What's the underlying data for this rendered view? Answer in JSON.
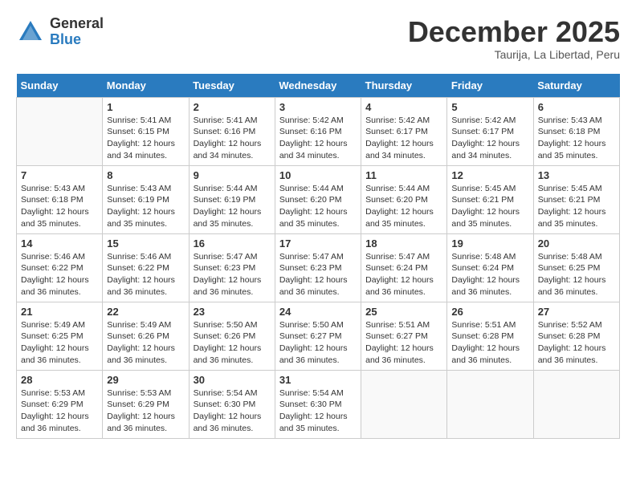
{
  "logo": {
    "general": "General",
    "blue": "Blue"
  },
  "header": {
    "month": "December 2025",
    "location": "Taurija, La Libertad, Peru"
  },
  "weekdays": [
    "Sunday",
    "Monday",
    "Tuesday",
    "Wednesday",
    "Thursday",
    "Friday",
    "Saturday"
  ],
  "weeks": [
    [
      {
        "day": "",
        "empty": true
      },
      {
        "day": "1",
        "sunrise": "5:41 AM",
        "sunset": "6:15 PM",
        "daylight": "12 hours and 34 minutes."
      },
      {
        "day": "2",
        "sunrise": "5:41 AM",
        "sunset": "6:16 PM",
        "daylight": "12 hours and 34 minutes."
      },
      {
        "day": "3",
        "sunrise": "5:42 AM",
        "sunset": "6:16 PM",
        "daylight": "12 hours and 34 minutes."
      },
      {
        "day": "4",
        "sunrise": "5:42 AM",
        "sunset": "6:17 PM",
        "daylight": "12 hours and 34 minutes."
      },
      {
        "day": "5",
        "sunrise": "5:42 AM",
        "sunset": "6:17 PM",
        "daylight": "12 hours and 34 minutes."
      },
      {
        "day": "6",
        "sunrise": "5:43 AM",
        "sunset": "6:18 PM",
        "daylight": "12 hours and 35 minutes."
      }
    ],
    [
      {
        "day": "7",
        "sunrise": "5:43 AM",
        "sunset": "6:18 PM",
        "daylight": "12 hours and 35 minutes."
      },
      {
        "day": "8",
        "sunrise": "5:43 AM",
        "sunset": "6:19 PM",
        "daylight": "12 hours and 35 minutes."
      },
      {
        "day": "9",
        "sunrise": "5:44 AM",
        "sunset": "6:19 PM",
        "daylight": "12 hours and 35 minutes."
      },
      {
        "day": "10",
        "sunrise": "5:44 AM",
        "sunset": "6:20 PM",
        "daylight": "12 hours and 35 minutes."
      },
      {
        "day": "11",
        "sunrise": "5:44 AM",
        "sunset": "6:20 PM",
        "daylight": "12 hours and 35 minutes."
      },
      {
        "day": "12",
        "sunrise": "5:45 AM",
        "sunset": "6:21 PM",
        "daylight": "12 hours and 35 minutes."
      },
      {
        "day": "13",
        "sunrise": "5:45 AM",
        "sunset": "6:21 PM",
        "daylight": "12 hours and 35 minutes."
      }
    ],
    [
      {
        "day": "14",
        "sunrise": "5:46 AM",
        "sunset": "6:22 PM",
        "daylight": "12 hours and 36 minutes."
      },
      {
        "day": "15",
        "sunrise": "5:46 AM",
        "sunset": "6:22 PM",
        "daylight": "12 hours and 36 minutes."
      },
      {
        "day": "16",
        "sunrise": "5:47 AM",
        "sunset": "6:23 PM",
        "daylight": "12 hours and 36 minutes."
      },
      {
        "day": "17",
        "sunrise": "5:47 AM",
        "sunset": "6:23 PM",
        "daylight": "12 hours and 36 minutes."
      },
      {
        "day": "18",
        "sunrise": "5:47 AM",
        "sunset": "6:24 PM",
        "daylight": "12 hours and 36 minutes."
      },
      {
        "day": "19",
        "sunrise": "5:48 AM",
        "sunset": "6:24 PM",
        "daylight": "12 hours and 36 minutes."
      },
      {
        "day": "20",
        "sunrise": "5:48 AM",
        "sunset": "6:25 PM",
        "daylight": "12 hours and 36 minutes."
      }
    ],
    [
      {
        "day": "21",
        "sunrise": "5:49 AM",
        "sunset": "6:25 PM",
        "daylight": "12 hours and 36 minutes."
      },
      {
        "day": "22",
        "sunrise": "5:49 AM",
        "sunset": "6:26 PM",
        "daylight": "12 hours and 36 minutes."
      },
      {
        "day": "23",
        "sunrise": "5:50 AM",
        "sunset": "6:26 PM",
        "daylight": "12 hours and 36 minutes."
      },
      {
        "day": "24",
        "sunrise": "5:50 AM",
        "sunset": "6:27 PM",
        "daylight": "12 hours and 36 minutes."
      },
      {
        "day": "25",
        "sunrise": "5:51 AM",
        "sunset": "6:27 PM",
        "daylight": "12 hours and 36 minutes."
      },
      {
        "day": "26",
        "sunrise": "5:51 AM",
        "sunset": "6:28 PM",
        "daylight": "12 hours and 36 minutes."
      },
      {
        "day": "27",
        "sunrise": "5:52 AM",
        "sunset": "6:28 PM",
        "daylight": "12 hours and 36 minutes."
      }
    ],
    [
      {
        "day": "28",
        "sunrise": "5:53 AM",
        "sunset": "6:29 PM",
        "daylight": "12 hours and 36 minutes."
      },
      {
        "day": "29",
        "sunrise": "5:53 AM",
        "sunset": "6:29 PM",
        "daylight": "12 hours and 36 minutes."
      },
      {
        "day": "30",
        "sunrise": "5:54 AM",
        "sunset": "6:30 PM",
        "daylight": "12 hours and 36 minutes."
      },
      {
        "day": "31",
        "sunrise": "5:54 AM",
        "sunset": "6:30 PM",
        "daylight": "12 hours and 35 minutes."
      },
      {
        "day": "",
        "empty": true
      },
      {
        "day": "",
        "empty": true
      },
      {
        "day": "",
        "empty": true
      }
    ]
  ],
  "labels": {
    "sunrise": "Sunrise:",
    "sunset": "Sunset:",
    "daylight": "Daylight:"
  }
}
